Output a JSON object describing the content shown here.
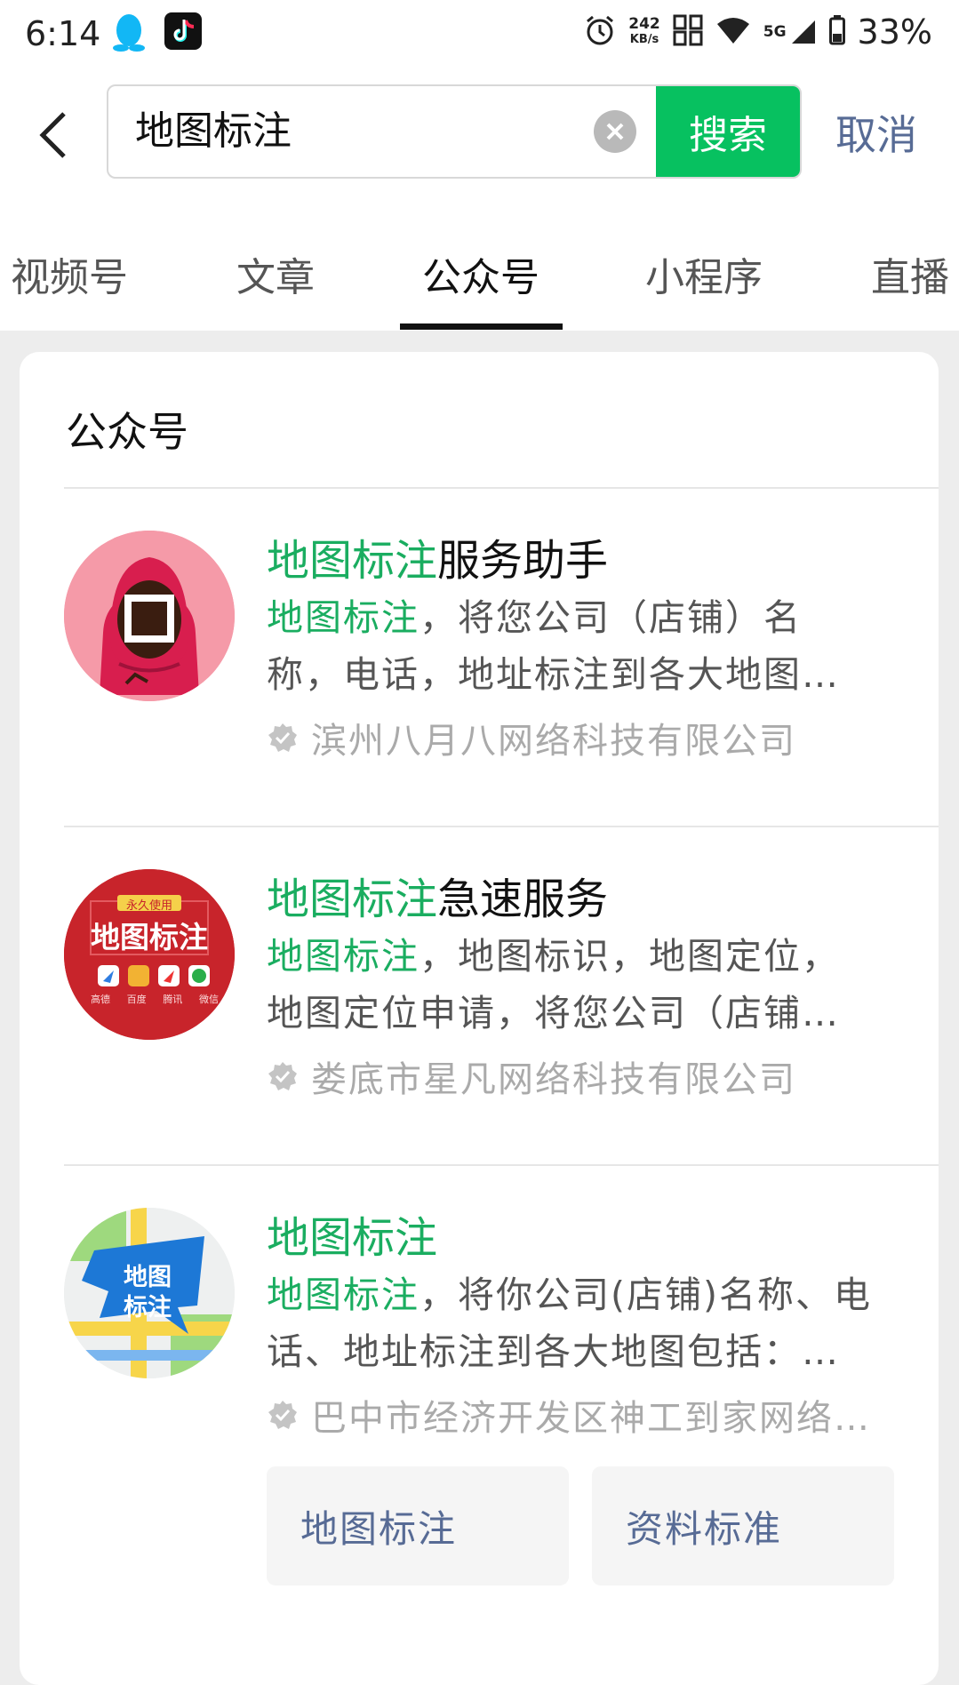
{
  "status_bar": {
    "time": "6:14",
    "net_speed_value": "242",
    "net_speed_unit": "KB/s",
    "network": "5G",
    "battery": "33%"
  },
  "search": {
    "query": "地图标注",
    "search_label": "搜索",
    "cancel_label": "取消"
  },
  "tabs": [
    {
      "label": "视频号",
      "active": false
    },
    {
      "label": "文章",
      "active": false
    },
    {
      "label": "公众号",
      "active": true
    },
    {
      "label": "小程序",
      "active": false
    },
    {
      "label": "直播",
      "active": false
    }
  ],
  "section_title": "公众号",
  "results": [
    {
      "name_highlight": "地图标注",
      "name_rest": "服务助手",
      "desc_highlight": "地图标注",
      "desc_line1_rest": "，将您公司（店铺）名",
      "desc_line2": "称，电话，地址标注到各大地图…",
      "company": "滨州八月八网络科技有限公司"
    },
    {
      "name_highlight": "地图标注",
      "name_rest": "急速服务",
      "desc_highlight": "地图标注",
      "desc_line1_rest": "，地图标识，地图定位，",
      "desc_line2": "地图定位申请，将您公司（店铺…",
      "company": "娄底市星凡网络科技有限公司",
      "avatar_texts": {
        "badge": "永久使用",
        "title": "地图标注",
        "apps": [
          "高德",
          "百度",
          "腾讯",
          "微信"
        ]
      }
    },
    {
      "name_highlight": "地图标注",
      "name_rest": "",
      "desc_highlight": "地图标注",
      "desc_line1_rest": "，将你公司(店铺)名称、电",
      "desc_line2": "话、地址标注到各大地图包括：…",
      "company": "巴中市经济开发区神工到家网络…",
      "avatar_texts": {
        "line1": "地图",
        "line2": "标注"
      }
    }
  ],
  "chips": [
    "地图标注",
    "资料标准"
  ],
  "colors": {
    "accent_green": "#07c160",
    "highlight_green": "#1aad60",
    "link_blue": "#576b95"
  }
}
